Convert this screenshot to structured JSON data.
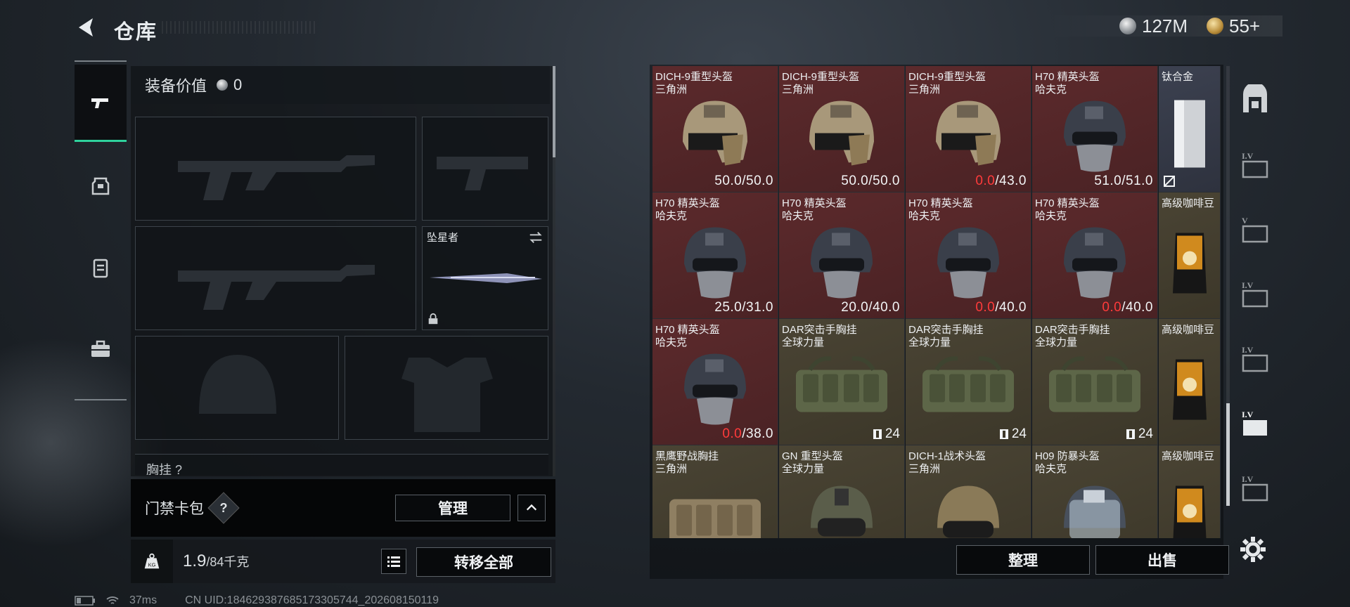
{
  "header": {
    "title": "仓库",
    "currency": [
      {
        "icon": "silver-coin-icon",
        "value": "127M"
      },
      {
        "icon": "gold-coin-icon",
        "value": "55+"
      }
    ]
  },
  "left_panel": {
    "equip_value_label": "装备价值",
    "equip_value": "0",
    "melee_slot_label": "坠星者",
    "partial_section_label": "胸挂 ?",
    "card_bag_label": "门禁卡包",
    "manage_label": "管理",
    "weight_value": "1.9",
    "weight_limit": "/84千克",
    "transfer_all_label": "转移全部"
  },
  "inventory": {
    "sort_label": "整理",
    "sell_label": "出售",
    "items": [
      {
        "name": "DICH-9重型头盔",
        "sub": "三角洲",
        "cur": "50.0",
        "max": "/50.0",
        "low": false,
        "kind": "helmet-tan",
        "bg": "red"
      },
      {
        "name": "DICH-9重型头盔",
        "sub": "三角洲",
        "cur": "50.0",
        "max": "/50.0",
        "low": false,
        "kind": "helmet-tan",
        "bg": "red"
      },
      {
        "name": "DICH-9重型头盔",
        "sub": "三角洲",
        "cur": "0.0",
        "max": "/43.0",
        "low": true,
        "kind": "helmet-tan",
        "bg": "red"
      },
      {
        "name": "H70 精英头盔",
        "sub": "哈夫克",
        "cur": "51.0",
        "max": "/51.0",
        "low": false,
        "kind": "helmet-grey",
        "bg": "red"
      },
      {
        "name": "钛合金",
        "sub": "",
        "kind": "ingot",
        "bg": "blue",
        "narrow": true
      },
      {
        "name": "H70 精英头盔",
        "sub": "哈夫克",
        "cur": "25.0",
        "max": "/31.0",
        "low": false,
        "kind": "helmet-grey",
        "bg": "red"
      },
      {
        "name": "H70 精英头盔",
        "sub": "哈夫克",
        "cur": "20.0",
        "max": "/40.0",
        "low": false,
        "kind": "helmet-grey",
        "bg": "red"
      },
      {
        "name": "H70 精英头盔",
        "sub": "哈夫克",
        "cur": "0.0",
        "max": "/40.0",
        "low": true,
        "kind": "helmet-grey",
        "bg": "red"
      },
      {
        "name": "H70 精英头盔",
        "sub": "哈夫克",
        "cur": "0.0",
        "max": "/40.0",
        "low": true,
        "kind": "helmet-grey",
        "bg": "red"
      },
      {
        "name": "高级咖啡豆",
        "sub": "",
        "kind": "coffee",
        "bg": "olive",
        "narrow": true
      },
      {
        "name": "H70 精英头盔",
        "sub": "哈夫克",
        "cur": "0.0",
        "max": "/38.0",
        "low": true,
        "kind": "helmet-grey",
        "bg": "red"
      },
      {
        "name": "DAR突击手胸挂",
        "sub": "全球力量",
        "count": "24",
        "kind": "rig-green",
        "bg": "olive"
      },
      {
        "name": "DAR突击手胸挂",
        "sub": "全球力量",
        "count": "24",
        "kind": "rig-green",
        "bg": "olive"
      },
      {
        "name": "DAR突击手胸挂",
        "sub": "全球力量",
        "count": "24",
        "kind": "rig-green",
        "bg": "olive"
      },
      {
        "name": "高级咖啡豆",
        "sub": "",
        "kind": "coffee",
        "bg": "olive",
        "narrow": true
      },
      {
        "name": "黑鹰野战胸挂",
        "sub": "三角洲",
        "kind": "rig-tan",
        "bg": "olive"
      },
      {
        "name": "GN 重型头盔",
        "sub": "全球力量",
        "kind": "helmet-olive",
        "bg": "olive"
      },
      {
        "name": "DICH-1战术头盔",
        "sub": "三角洲",
        "kind": "helmet-khaki",
        "bg": "olive"
      },
      {
        "name": "H09 防暴头盔",
        "sub": "哈夫克",
        "kind": "helmet-visor",
        "bg": "olive"
      },
      {
        "name": "高级咖啡豆",
        "sub": "",
        "kind": "coffee",
        "bg": "olive",
        "narrow": true
      }
    ]
  },
  "status_bar": {
    "ping": "37ms",
    "uid": "CN UID:184629387685173305744_202608150119"
  }
}
